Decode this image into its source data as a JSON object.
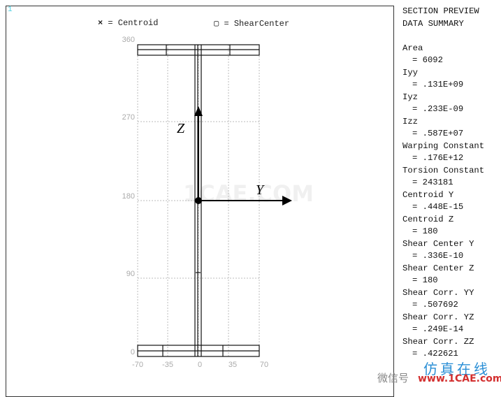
{
  "window_number": "1",
  "legend": {
    "centroid_symbol": "×",
    "centroid_label": "= Centroid",
    "shear_symbol": "▢",
    "shear_label": "= ShearCenter"
  },
  "plot": {
    "x_ticks": [
      "-70",
      "-35",
      "0",
      "35",
      "70"
    ],
    "y_ticks": [
      "360",
      "270",
      "180",
      "90",
      "0"
    ],
    "axis_y_label": "Y",
    "axis_z_label": "Z"
  },
  "summary": {
    "title1": "SECTION PREVIEW",
    "title2": "DATA SUMMARY",
    "items": [
      {
        "label": "Area",
        "value": "= 6092"
      },
      {
        "label": "Iyy",
        "value": "= .131E+09"
      },
      {
        "label": "Iyz",
        "value": "= .233E-09"
      },
      {
        "label": "Izz",
        "value": "= .587E+07"
      },
      {
        "label": "Warping Constant",
        "value": "= .176E+12"
      },
      {
        "label": "Torsion Constant",
        "value": "= 243181"
      },
      {
        "label": "Centroid Y",
        "value": "= .448E-15"
      },
      {
        "label": "Centroid Z",
        "value": "= 180"
      },
      {
        "label": "Shear Center Y",
        "value": "= .336E-10"
      },
      {
        "label": "Shear Center Z",
        "value": "= 180"
      },
      {
        "label": "Shear Corr. YY",
        "value": "= .507692"
      },
      {
        "label": "Shear Corr. YZ",
        "value": "= .249E-14"
      },
      {
        "label": "Shear Corr. ZZ",
        "value": "= .422621"
      }
    ]
  },
  "watermark": {
    "center": "1CAE.COM",
    "wechat": "微信号",
    "brand": "仿真在线",
    "url": "www.1CAE.com"
  }
}
